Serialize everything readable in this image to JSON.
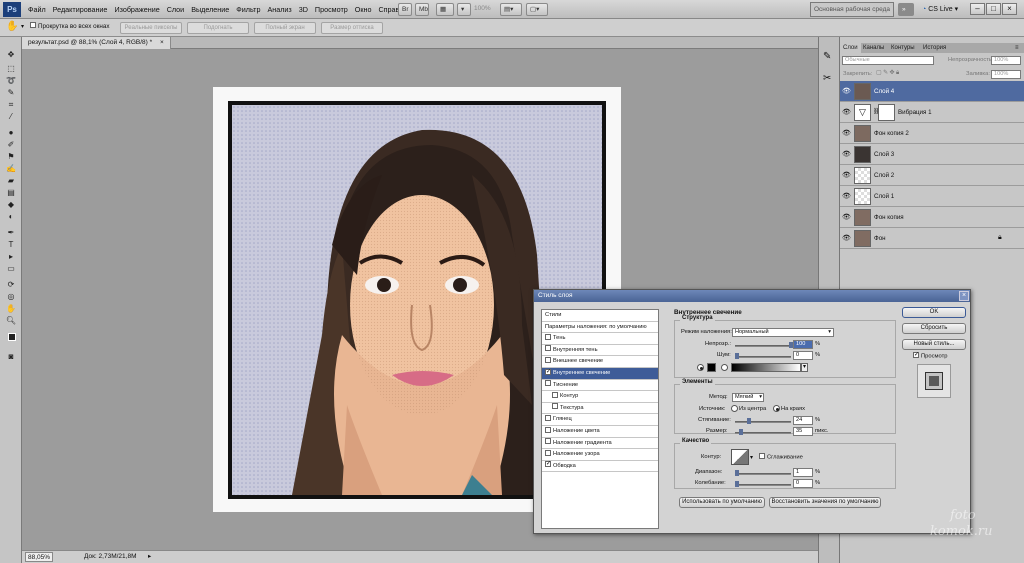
{
  "menubar": {
    "logo": "Ps",
    "items": [
      "Файл",
      "Редактирование",
      "Изображение",
      "Слои",
      "Выделение",
      "Фильтр",
      "Анализ",
      "3D",
      "Просмотр",
      "Окно",
      "Справка"
    ],
    "zoom": "100%",
    "workspace": "Основная рабочая среда",
    "cs_live": "CS Live",
    "win_controls": [
      "–",
      "□",
      "×"
    ]
  },
  "options": {
    "scroll_all": "Прокрутка во всех окнах",
    "buttons": [
      "Реальные пикселы",
      "Подогнать",
      "Полный экран",
      "Размер оттиска"
    ]
  },
  "document": {
    "tab": "результат.psd @ 88,1% (Слой 4, RGB/8) *",
    "zoom": "88,05%",
    "doc_info": "Док: 2,73M/21,8M"
  },
  "layers_panel": {
    "tabs": [
      "Слои",
      "Каналы",
      "Контуры",
      "История"
    ],
    "blend_mode": "Обычные",
    "opacity_label": "Непрозрачность:",
    "opacity_value": "100%",
    "lock_label": "Закрепить:",
    "fill_label": "Заливка:",
    "fill_value": "100%",
    "layers": [
      {
        "name": "Слой 4",
        "selected": true
      },
      {
        "name": "Вибрация 1",
        "selected": false
      },
      {
        "name": "Фон копия 2",
        "selected": false
      },
      {
        "name": "Слой 3",
        "selected": false
      },
      {
        "name": "Слой 2",
        "selected": false
      },
      {
        "name": "Слой 1",
        "selected": false
      },
      {
        "name": "Фон копия",
        "selected": false
      },
      {
        "name": "Фон",
        "selected": false
      }
    ]
  },
  "dialog": {
    "title": "Стиль слоя",
    "styles": [
      {
        "label": "Стили",
        "checkbox": false,
        "checked": false,
        "indent": false,
        "selected": false
      },
      {
        "label": "Параметры наложения: по умолчанию",
        "checkbox": false,
        "checked": false,
        "indent": false,
        "selected": false
      },
      {
        "label": "Тень",
        "checkbox": true,
        "checked": false,
        "indent": false,
        "selected": false
      },
      {
        "label": "Внутренняя тень",
        "checkbox": true,
        "checked": false,
        "indent": false,
        "selected": false
      },
      {
        "label": "Внешнее свечение",
        "checkbox": true,
        "checked": false,
        "indent": false,
        "selected": false
      },
      {
        "label": "Внутреннее свечение",
        "checkbox": true,
        "checked": true,
        "indent": false,
        "selected": true
      },
      {
        "label": "Тиснение",
        "checkbox": true,
        "checked": false,
        "indent": false,
        "selected": false
      },
      {
        "label": "Контур",
        "checkbox": true,
        "checked": false,
        "indent": true,
        "selected": false
      },
      {
        "label": "Текстура",
        "checkbox": true,
        "checked": false,
        "indent": true,
        "selected": false
      },
      {
        "label": "Глянец",
        "checkbox": true,
        "checked": false,
        "indent": false,
        "selected": false
      },
      {
        "label": "Наложение цвета",
        "checkbox": true,
        "checked": false,
        "indent": false,
        "selected": false
      },
      {
        "label": "Наложение градиента",
        "checkbox": true,
        "checked": false,
        "indent": false,
        "selected": false
      },
      {
        "label": "Наложение узора",
        "checkbox": true,
        "checked": false,
        "indent": false,
        "selected": false
      },
      {
        "label": "Обводка",
        "checkbox": true,
        "checked": true,
        "indent": false,
        "selected": false
      }
    ],
    "section": "Внутреннее свечение",
    "structure": {
      "title": "Структура",
      "blend_label": "Режим наложения:",
      "blend_value": "Нормальный",
      "opacity_label": "Непрозр.:",
      "opacity_value": "100",
      "noise_label": "Шум:",
      "noise_value": "0",
      "unit": "%"
    },
    "elements": {
      "title": "Элементы",
      "method_label": "Метод:",
      "method_value": "Мягкий",
      "source_label": "Источник:",
      "source_center": "Из центра",
      "source_edge": "На краях",
      "choke_label": "Стягивание:",
      "choke_value": "24",
      "size_label": "Размер:",
      "size_value": "35",
      "size_unit": "пикс."
    },
    "quality": {
      "title": "Качество",
      "contour_label": "Контур:",
      "antialias": "Сглаживание",
      "range_label": "Диапазон:",
      "range_value": "1",
      "jitter_label": "Колебание:",
      "jitter_value": "0"
    },
    "default_buttons": [
      "Использовать по умолчанию",
      "Восстановить значения по умолчанию"
    ],
    "ok": "OK",
    "reset": "Сбросить",
    "new_style": "Новый стиль...",
    "preview": "Просмотр"
  },
  "watermark": [
    "foto",
    "komok.ru"
  ]
}
